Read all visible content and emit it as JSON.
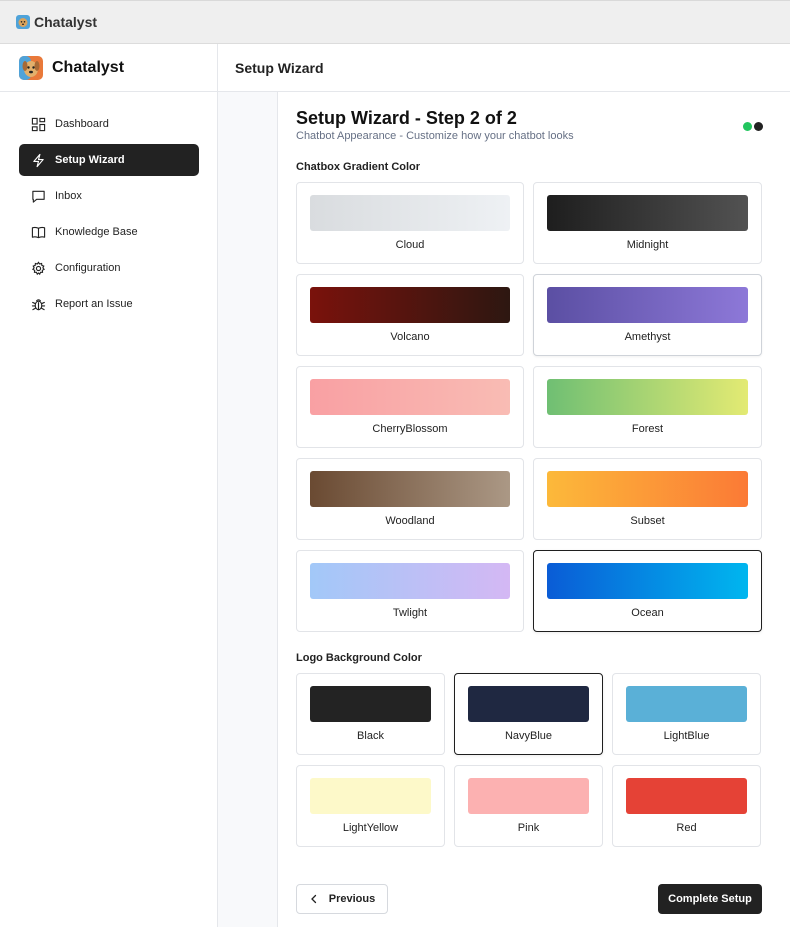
{
  "window": {
    "title": "Chatalyst",
    "icon": "dog-avatar-icon"
  },
  "sidebar": {
    "brand": "Chatalyst",
    "items": [
      {
        "label": "Dashboard",
        "icon": "dashboard-icon",
        "active": false
      },
      {
        "label": "Setup Wizard",
        "icon": "lightning-icon",
        "active": true
      },
      {
        "label": "Inbox",
        "icon": "chat-bubble-icon",
        "active": false
      },
      {
        "label": "Knowledge Base",
        "icon": "book-icon",
        "active": false
      },
      {
        "label": "Configuration",
        "icon": "gear-icon",
        "active": false
      },
      {
        "label": "Report an Issue",
        "icon": "bug-icon",
        "active": false
      }
    ]
  },
  "header": {
    "title": "Setup Wizard"
  },
  "wizard": {
    "title": "Setup Wizard - Step 2 of 2",
    "subtitle": "Chatbot Appearance - Customize how your chatbot looks",
    "step_colors": [
      "#22c55e",
      "#222222"
    ]
  },
  "gradient_section": {
    "label": "Chatbox Gradient Color",
    "selected": "Ocean",
    "options": [
      {
        "name": "Cloud",
        "from": "#d9dcdf",
        "to": "#eef1f4"
      },
      {
        "name": "Midnight",
        "from": "#1e1e1e",
        "to": "#525252"
      },
      {
        "name": "Volcano",
        "from": "#7a120c",
        "to": "#2d1711"
      },
      {
        "name": "Amethyst",
        "from": "#5b4fa3",
        "to": "#8d78d8"
      },
      {
        "name": "CherryBlossom",
        "from": "#f9a0a3",
        "to": "#f9bcb4"
      },
      {
        "name": "Forest",
        "from": "#6fbf73",
        "to": "#e3ea73"
      },
      {
        "name": "Woodland",
        "from": "#6a4a32",
        "to": "#ab9885"
      },
      {
        "name": "Subset",
        "from": "#fcb93a",
        "to": "#fb7a36"
      },
      {
        "name": "Twlight",
        "from": "#a2c8f8",
        "to": "#d4b8f4"
      },
      {
        "name": "Ocean",
        "from": "#0a5cd6",
        "to": "#00b6ef"
      }
    ]
  },
  "logo_section": {
    "label": "Logo Background Color",
    "selected": "NavyBlue",
    "options": [
      {
        "name": "Black",
        "color": "#232323"
      },
      {
        "name": "NavyBlue",
        "color": "#1f2841"
      },
      {
        "name": "LightBlue",
        "color": "#5ab0d7"
      },
      {
        "name": "LightYellow",
        "color": "#fdf9c9"
      },
      {
        "name": "Pink",
        "color": "#fcb1b1"
      },
      {
        "name": "Red",
        "color": "#e54236"
      }
    ]
  },
  "buttons": {
    "previous": "Previous",
    "complete": "Complete Setup"
  }
}
